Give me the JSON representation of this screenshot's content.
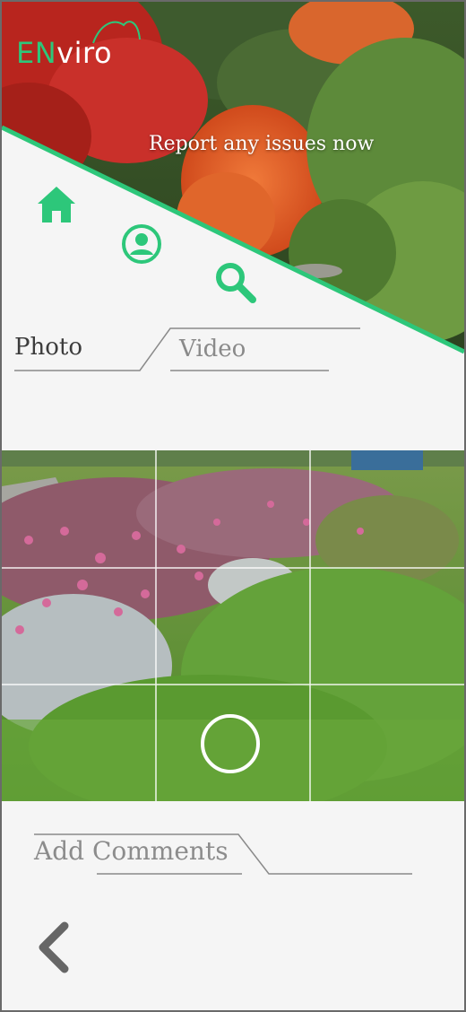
{
  "app": {
    "logo_part1": "EN",
    "logo_part2": "viro",
    "tagline": "Report any issues now"
  },
  "tabs": [
    {
      "label": "Photo",
      "active": true
    },
    {
      "label": "Video",
      "active": false
    }
  ],
  "comments": {
    "placeholder": "Add Comments"
  },
  "icons": {
    "home": "home-icon",
    "profile": "user-icon",
    "search": "search-icon",
    "back": "chevron-left-icon",
    "shutter": "shutter-ring"
  },
  "colors": {
    "accent": "#2dc77a",
    "background": "#f5f5f5",
    "text_dark": "#3c3c3c",
    "text_muted": "#8a8a8a"
  }
}
